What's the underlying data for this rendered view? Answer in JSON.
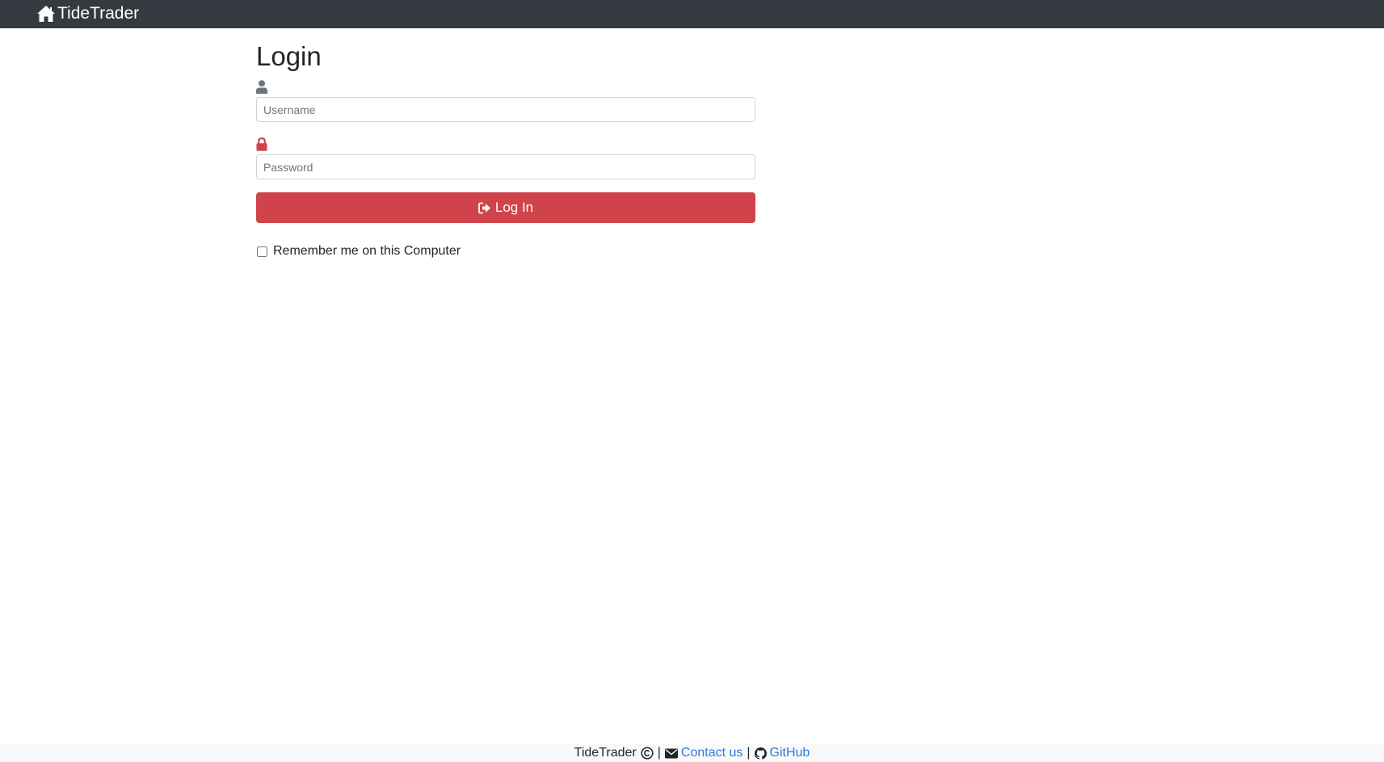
{
  "navbar": {
    "brand": "TideTrader"
  },
  "login": {
    "title": "Login",
    "username_placeholder": "Username",
    "password_placeholder": "Password",
    "submit_label": "Log In",
    "remember_label": "Remember me on this Computer",
    "remember_checked": false
  },
  "footer": {
    "brand": "TideTrader",
    "separator": "|",
    "contact_label": "Contact us",
    "github_label": "GitHub"
  },
  "colors": {
    "navbar_bg": "#343a40",
    "button_bg": "#d0434b",
    "lock_icon": "#d0434b",
    "link": "#2a7bde",
    "footer_bg": "#f8f9fa"
  },
  "icons": {
    "brand": "home-icon",
    "username": "user-icon",
    "password": "lock-icon",
    "submit": "sign-in-icon",
    "copyright": "copyright-icon",
    "contact": "envelope-icon",
    "github": "github-icon"
  }
}
